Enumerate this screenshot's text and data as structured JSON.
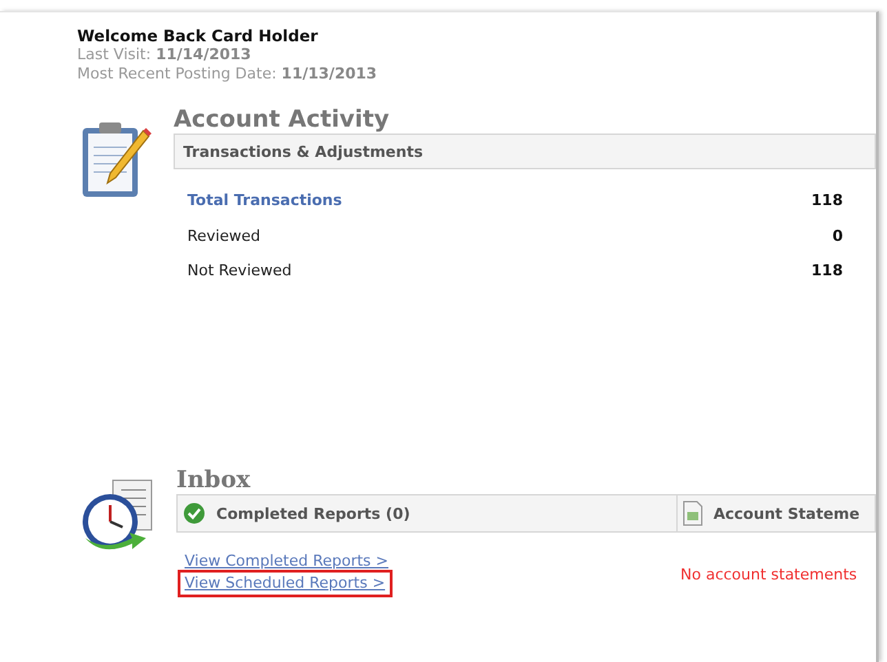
{
  "welcome": {
    "title": "Welcome Back Card Holder",
    "last_visit_label": "Last Visit:",
    "last_visit": "11/14/2013",
    "posting_label": "Most Recent Posting Date:",
    "posting_date": "11/13/2013"
  },
  "activity": {
    "title": "Account Activity",
    "header": "Transactions & Adjustments",
    "rows": [
      {
        "label": "Total Transactions",
        "value": "118",
        "kind": "link"
      },
      {
        "label": "Reviewed",
        "value": "0",
        "kind": "text"
      },
      {
        "label": "Not Reviewed",
        "value": "118",
        "kind": "text"
      }
    ]
  },
  "inbox": {
    "title": "Inbox",
    "completed_header": "Completed Reports (0)",
    "statements_header": "Account Stateme",
    "links": [
      {
        "label": "View Completed Reports >",
        "highlighted": false
      },
      {
        "label": "View Scheduled Reports >",
        "highlighted": true
      }
    ],
    "statements_message": "No account statements"
  }
}
